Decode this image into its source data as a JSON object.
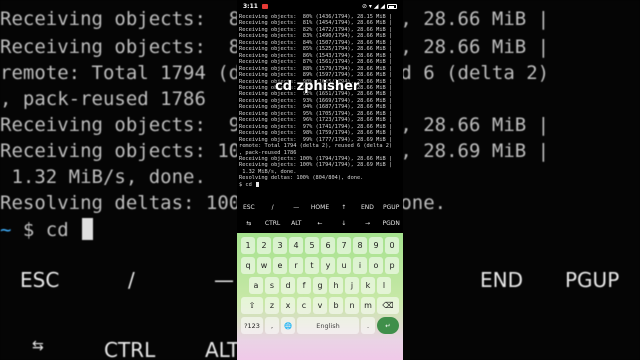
{
  "background": {
    "lines": [
      "Receiving objects:  81% (1454/1794), 28.66 MiB |",
      "Receiving objects:  82% (1472/1794), 28.66 MiB |",
      "remote: Total 1794 (delta 2), reused 6 (delta 2)",
      ", pack-reused 1786",
      "Receiving objects:  98% (1759/1794), 28.66 MiB |",
      "Receiving objects: 100% (1794/1794), 28.69 MiB |",
      " 1.32 MiB/s, done.",
      "Resolving deltas: 100% (804/804), done."
    ],
    "prompt_tilde": "~",
    "prompt": " $ cd ",
    "extra_keys_row1": [
      "ESC",
      "/",
      "—",
      "END",
      "PGUP"
    ],
    "extra_keys_row2": [
      "⇆",
      "CTRL",
      "ALT"
    ]
  },
  "status_bar": {
    "time": "3:11",
    "right_text": "⊘ ▾ ◢ ◢"
  },
  "terminal": {
    "lines": [
      "Receiving objects:  80% (1436/1794), 28.15 MiB |",
      "Receiving objects:  81% (1454/1794), 28.66 MiB |",
      "Receiving objects:  82% (1472/1794), 28.66 MiB |",
      "Receiving objects:  83% (1490/1794), 28.66 MiB |",
      "Receiving objects:  84% (1507/1794), 28.66 MiB |",
      "Receiving objects:  85% (1525/1794), 28.66 MiB |",
      "Receiving objects:  86% (1543/1794), 28.66 MiB |",
      "Receiving objects:  87% (1561/1794), 28.66 MiB |",
      "Receiving objects:  88% (1579/1794), 28.66 MiB |",
      "Receiving objects:  89% (1597/1794), 28.66 MiB |",
      "Receiving objects:  90% (1615/1794), 28.66 MiB |",
      "Receiving objects:  91% (1633/1794), 28.66 MiB |",
      "Receiving objects:  92% (1651/1794), 28.66 MiB |",
      "Receiving objects:  93% (1669/1794), 28.66 MiB |",
      "Receiving objects:  94% (1687/1794), 28.66 MiB |",
      "Receiving objects:  95% (1705/1794), 28.66 MiB |",
      "Receiving objects:  96% (1723/1794), 28.66 MiB |",
      "Receiving objects:  97% (1741/1794), 28.66 MiB |",
      "Receiving objects:  98% (1759/1794), 28.66 MiB |",
      "Receiving objects:  99% (1777/1794), 28.69 MiB |",
      "remote: Total 1794 (delta 2), reused 6 (delta 2)",
      ", pack-reused 1786",
      "Receiving objects: 100% (1794/1794), 28.66 MiB |",
      "Receiving objects: 100% (1794/1794), 28.69 MiB |",
      " 1.32 MiB/s, done.",
      "Resolving deltas: 100% (804/804), done."
    ],
    "prompt": "$ cd "
  },
  "caption": "cd zphisher",
  "extra_keys": {
    "row1": [
      "ESC",
      "/",
      "—",
      "HOME",
      "↑",
      "END",
      "PGUP"
    ],
    "row2": [
      "⇆",
      "CTRL",
      "ALT",
      "←",
      "↓",
      "→",
      "PGDN"
    ]
  },
  "keyboard": {
    "numbers": [
      "1",
      "2",
      "3",
      "4",
      "5",
      "6",
      "7",
      "8",
      "9",
      "0"
    ],
    "row1": [
      "q",
      "w",
      "e",
      "r",
      "t",
      "y",
      "u",
      "i",
      "o",
      "p"
    ],
    "row2": [
      "a",
      "s",
      "d",
      "f",
      "g",
      "h",
      "j",
      "k",
      "l"
    ],
    "row3": [
      "⇧",
      "z",
      "x",
      "c",
      "v",
      "b",
      "n",
      "m",
      "⌫"
    ],
    "symbols_key": "?123",
    "comma_key": ",",
    "globe_key": "🌐",
    "space_label": "English",
    "period_key": ".",
    "enter_key": "↵"
  }
}
